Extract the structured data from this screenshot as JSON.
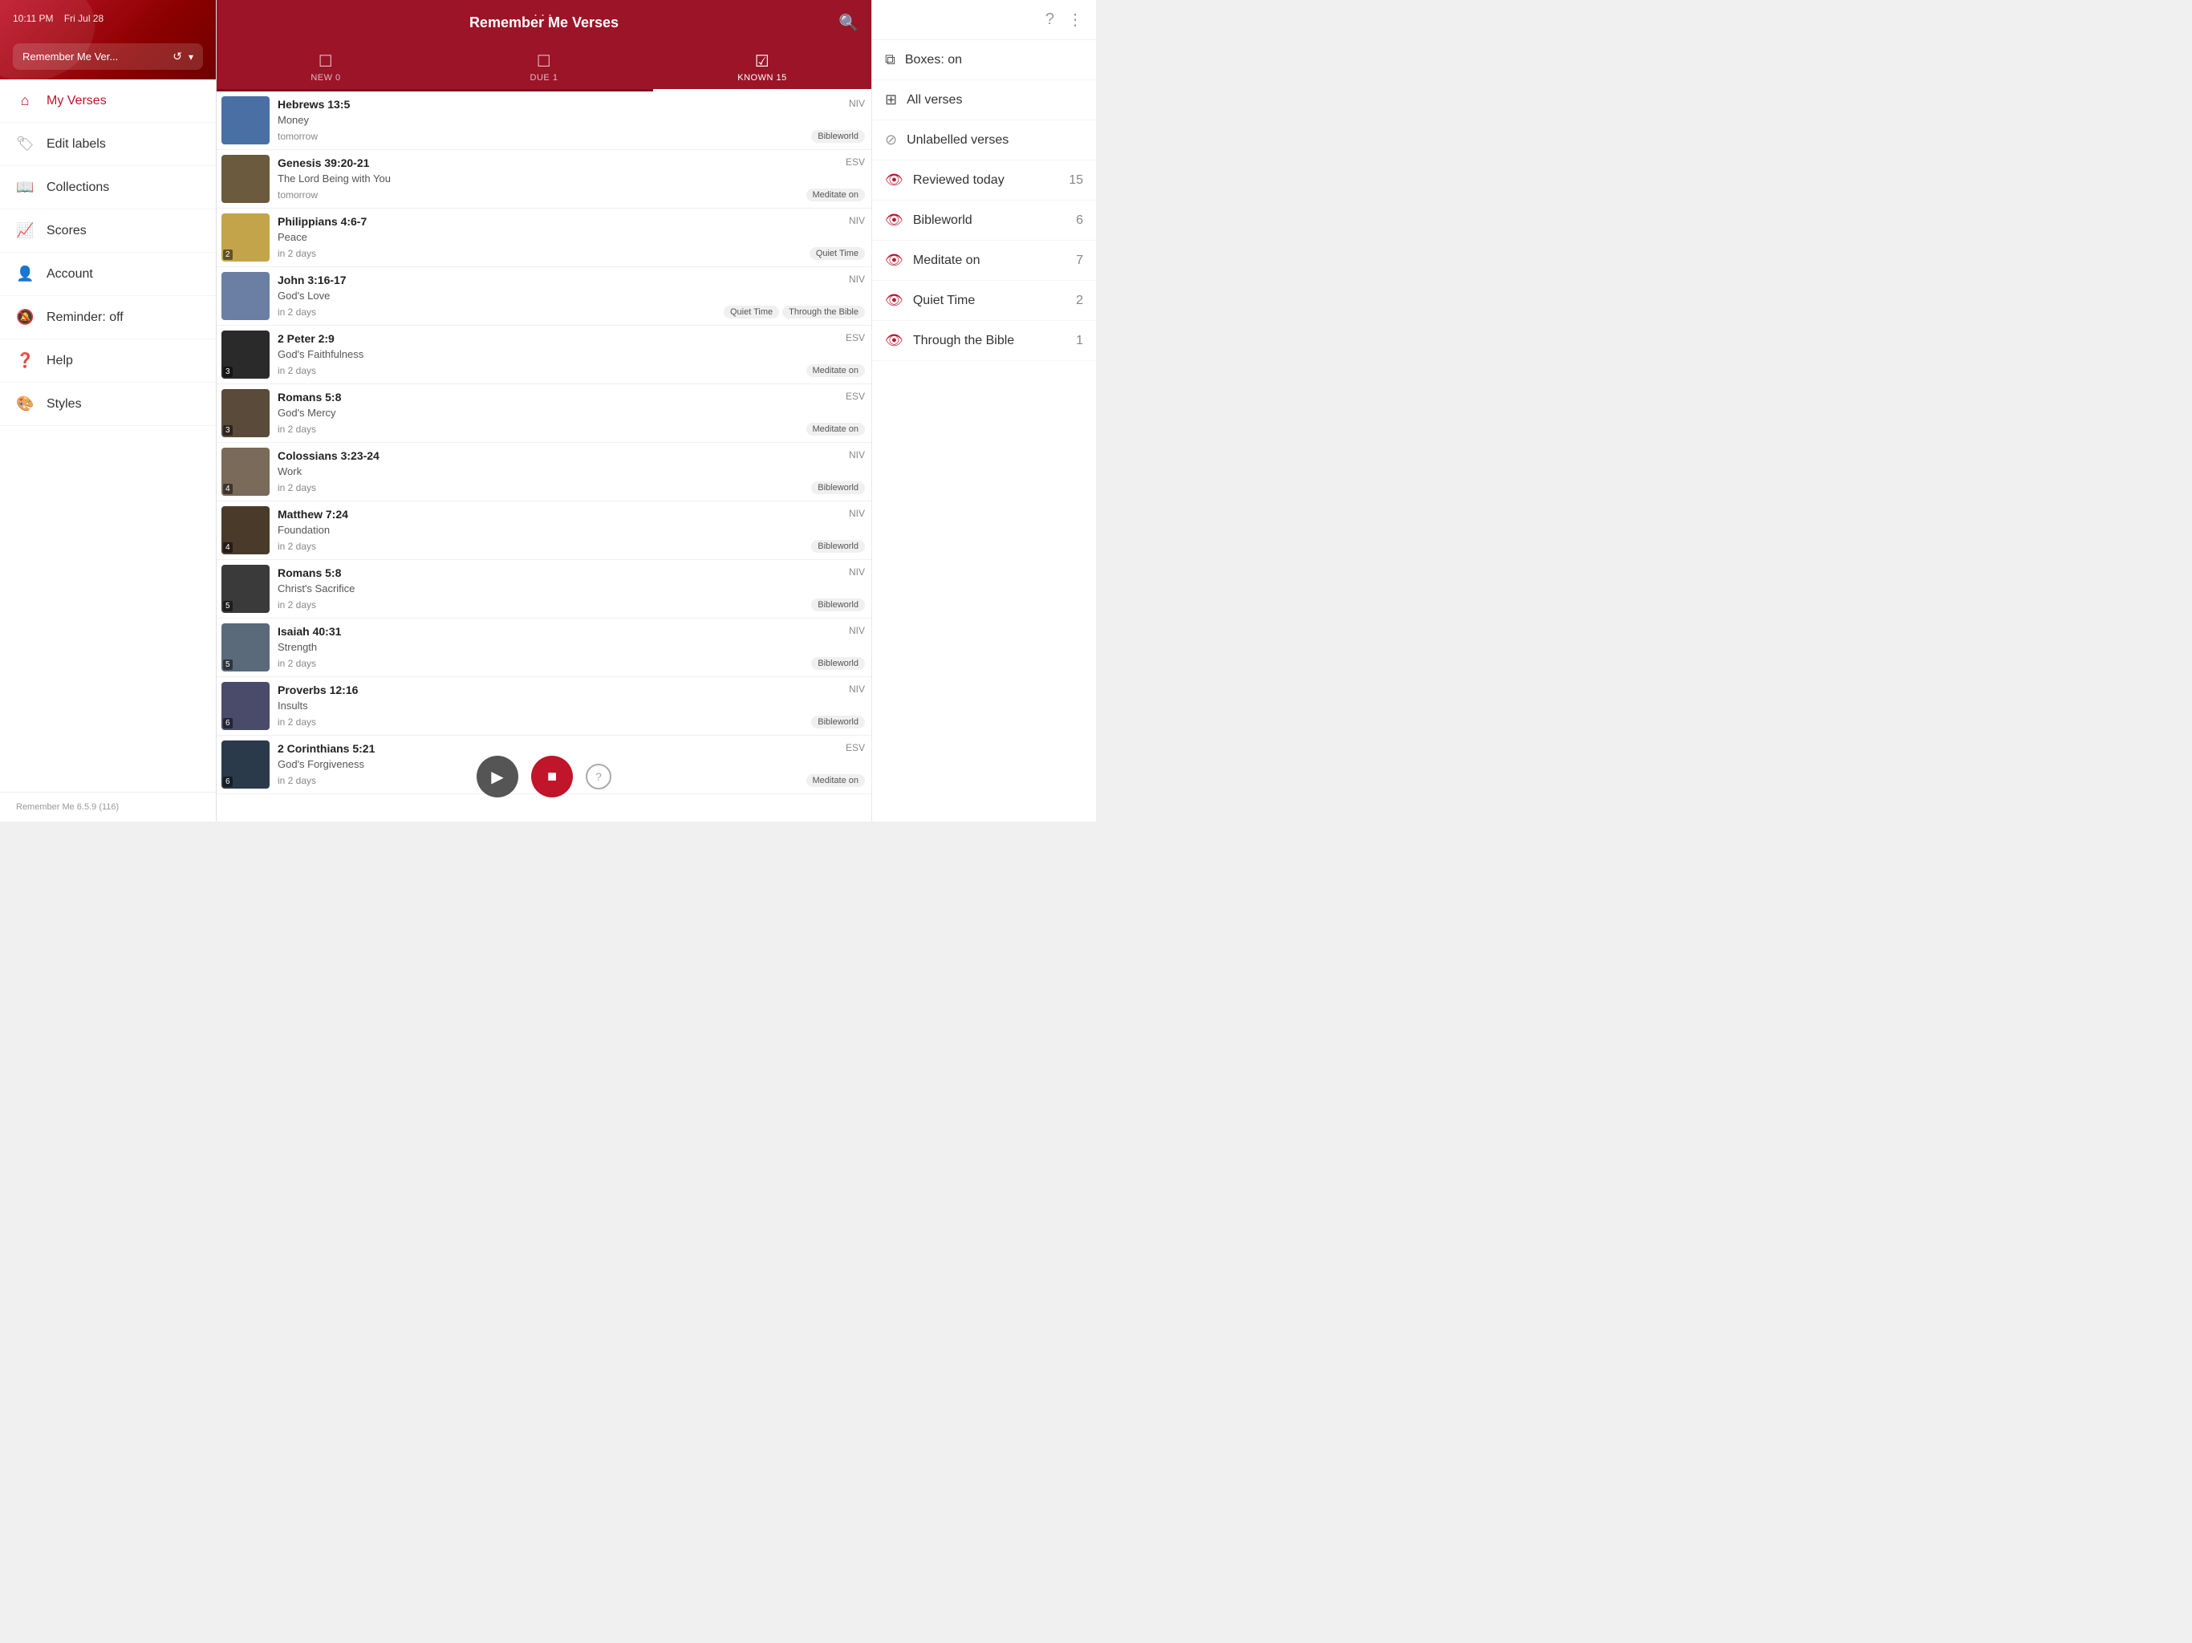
{
  "app": {
    "time": "10:11 PM",
    "date": "Fri Jul 28",
    "name": "Remember Me Ver...",
    "version": "Remember Me 6.5.9 (116)"
  },
  "sidebar": {
    "nav_items": [
      {
        "id": "my-verses",
        "label": "My Verses",
        "icon": "🏠",
        "active": true
      },
      {
        "id": "edit-labels",
        "label": "Edit labels",
        "icon": "🏷"
      },
      {
        "id": "collections",
        "label": "Collections",
        "icon": "📖"
      },
      {
        "id": "scores",
        "label": "Scores",
        "icon": "📈"
      },
      {
        "id": "account",
        "label": "Account",
        "icon": "👤"
      },
      {
        "id": "reminder",
        "label": "Reminder: off",
        "icon": "🔕"
      },
      {
        "id": "help",
        "label": "Help",
        "icon": "❓"
      },
      {
        "id": "styles",
        "label": "Styles",
        "icon": "🎨"
      }
    ]
  },
  "header": {
    "title": "Remember Me Verses",
    "dots": "···"
  },
  "tabs": [
    {
      "id": "new",
      "label": "NEW 0",
      "icon": "☐",
      "active": false
    },
    {
      "id": "due",
      "label": "DUE 1",
      "icon": "☐",
      "active": false
    },
    {
      "id": "known",
      "label": "KNOWN 15",
      "icon": "☑",
      "active": true
    }
  ],
  "verses": [
    {
      "ref": "Hebrews 13:5",
      "topic": "Money",
      "translation": "NIV",
      "due": "tomorrow",
      "tags": [
        "Bibleworld"
      ],
      "box": null,
      "bg": "#4a6fa5"
    },
    {
      "ref": "Genesis 39:20-21",
      "topic": "The Lord Being with You",
      "translation": "ESV",
      "due": "tomorrow",
      "tags": [
        "Meditate on"
      ],
      "box": null,
      "bg": "#6b5a3e"
    },
    {
      "ref": "Philippians 4:6-7",
      "topic": "Peace",
      "translation": "NIV",
      "due": "in 2 days",
      "tags": [
        "Quiet Time"
      ],
      "box": "2",
      "bg": "#c4a44a"
    },
    {
      "ref": "John 3:16-17",
      "topic": "God's Love",
      "translation": "NIV",
      "due": "in 2 days",
      "tags": [
        "Quiet Time",
        "Through the Bible"
      ],
      "box": null,
      "bg": "#6b7fa5"
    },
    {
      "ref": "2 Peter 2:9",
      "topic": "God's Faithfulness",
      "translation": "ESV",
      "due": "in 2 days",
      "tags": [
        "Meditate on"
      ],
      "box": "3",
      "bg": "#2a2a2a"
    },
    {
      "ref": "Romans 5:8",
      "topic": "God's Mercy",
      "translation": "ESV",
      "due": "in 2 days",
      "tags": [
        "Meditate on"
      ],
      "box": "3",
      "bg": "#5a4a3a"
    },
    {
      "ref": "Colossians 3:23-24",
      "topic": "Work",
      "translation": "NIV",
      "due": "in 2 days",
      "tags": [
        "Bibleworld"
      ],
      "box": "4",
      "bg": "#7a6a5a"
    },
    {
      "ref": "Matthew 7:24",
      "topic": "Foundation",
      "translation": "NIV",
      "due": "in 2 days",
      "tags": [
        "Bibleworld"
      ],
      "box": "4",
      "bg": "#4a3a2a"
    },
    {
      "ref": "Romans 5:8",
      "topic": "Christ's Sacrifice",
      "translation": "NIV",
      "due": "in 2 days",
      "tags": [
        "Bibleworld"
      ],
      "box": "5",
      "bg": "#3a3a3a"
    },
    {
      "ref": "Isaiah 40:31",
      "topic": "Strength",
      "translation": "NIV",
      "due": "in 2 days",
      "tags": [
        "Bibleworld"
      ],
      "box": "5",
      "bg": "#5a6a7a"
    },
    {
      "ref": "Proverbs 12:16",
      "topic": "Insults",
      "translation": "NIV",
      "due": "in 2 days",
      "tags": [
        "Bibleworld"
      ],
      "box": "6",
      "bg": "#4a4a6a"
    },
    {
      "ref": "2 Corinthians 5:21",
      "topic": "God's Forgiveness",
      "translation": "ESV",
      "due": "in 2 days",
      "tags": [
        "Meditate on"
      ],
      "box": "6",
      "bg": "#2a3a4a"
    }
  ],
  "playback": {
    "play_label": "▶",
    "stop_label": "■",
    "help_label": "?"
  },
  "right_panel": {
    "boxes_label": "Boxes: on",
    "all_verses_label": "All verses",
    "unlabelled_label": "Unlabelled verses",
    "filters": [
      {
        "id": "reviewed-today",
        "label": "Reviewed today",
        "count": "15"
      },
      {
        "id": "bibleworld",
        "label": "Bibleworld",
        "count": "6"
      },
      {
        "id": "meditate-on",
        "label": "Meditate on",
        "count": "7"
      },
      {
        "id": "quiet-time",
        "label": "Quiet Time",
        "count": "2"
      },
      {
        "id": "through-the-bible",
        "label": "Through the Bible",
        "count": "1"
      }
    ]
  }
}
